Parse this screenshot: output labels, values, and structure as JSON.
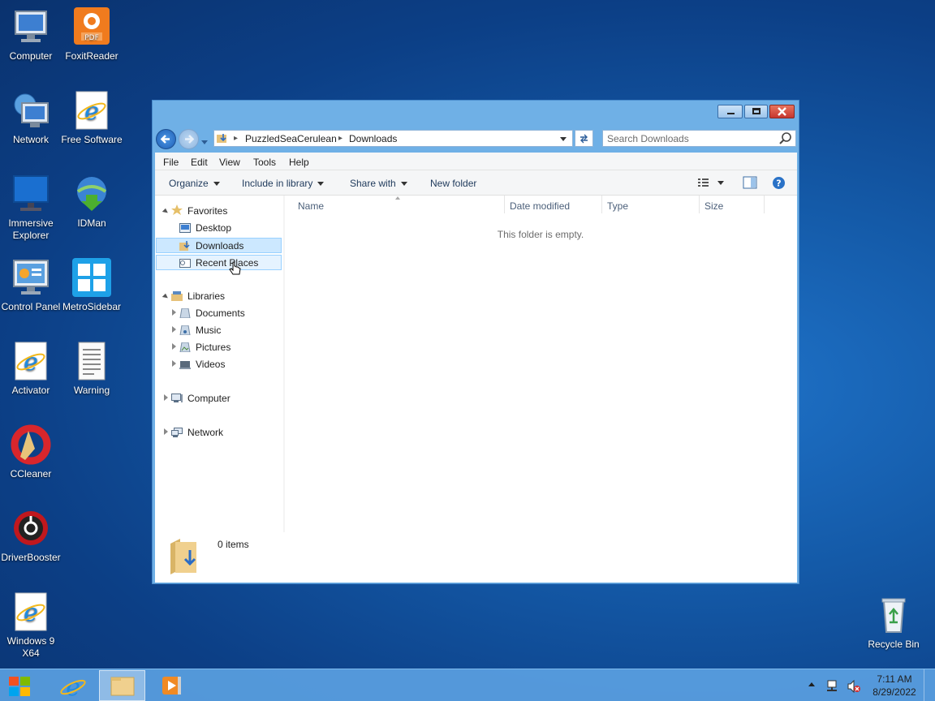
{
  "desktop": {
    "icons": [
      {
        "label": "Computer"
      },
      {
        "label": "FoxitReader"
      },
      {
        "label": "Network"
      },
      {
        "label": "Free Software"
      },
      {
        "label": "Immersive Explorer"
      },
      {
        "label": "IDMan"
      },
      {
        "label": "Control Panel"
      },
      {
        "label": "MetroSidebar"
      },
      {
        "label": "Activator"
      },
      {
        "label": "Warning"
      },
      {
        "label": "CCleaner"
      },
      {
        "label": "DriverBooster"
      },
      {
        "label": "Windows 9 X64"
      },
      {
        "label": "Recycle Bin"
      }
    ]
  },
  "window": {
    "breadcrumb": [
      "PuzzledSeaCerulean",
      "Downloads"
    ],
    "search_placeholder": "Search Downloads",
    "menu": [
      "File",
      "Edit",
      "View",
      "Tools",
      "Help"
    ],
    "commands": {
      "organize": "Organize",
      "include": "Include in library",
      "share": "Share with",
      "new_folder": "New folder"
    },
    "nav": {
      "favorites": "Favorites",
      "desktop": "Desktop",
      "downloads": "Downloads",
      "recent": "Recent Places",
      "libraries": "Libraries",
      "documents": "Documents",
      "music": "Music",
      "pictures": "Pictures",
      "videos": "Videos",
      "computer": "Computer",
      "network": "Network"
    },
    "columns": [
      "Name",
      "Date modified",
      "Type",
      "Size"
    ],
    "empty_message": "This folder is empty.",
    "item_count": "0 items"
  },
  "taskbar": {
    "time": "7:11 AM",
    "date": "8/29/2022"
  }
}
